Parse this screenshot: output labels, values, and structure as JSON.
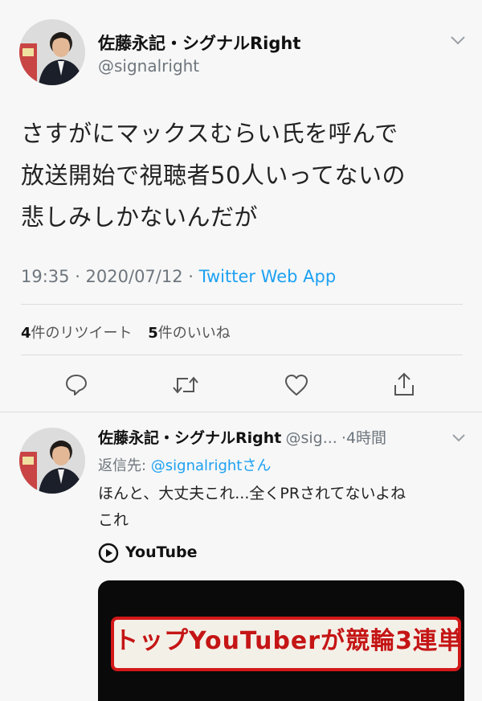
{
  "tweet": {
    "display_name": "佐藤永記・シグナルRight",
    "handle": "@signalright",
    "text_lines": [
      "さすがにマックスむらい氏を呼んで",
      "放送開始で視聴者50人いってないの",
      "悲しみしかないんだが"
    ],
    "time": "19:35 · 2020/07/12 · ",
    "source": "Twitter Web App",
    "retweet_count": "4",
    "retweet_label": "件のリツイート",
    "like_count": "5",
    "like_label": "件のいいね",
    "actions": [
      "reply-icon",
      "retweet-icon",
      "like-icon",
      "share-icon"
    ]
  },
  "reply": {
    "display_name": "佐藤永記・シグナルRight",
    "handle": "@sig...",
    "time": "·4時間",
    "reply_to_prefix": "返信先: ",
    "reply_to_handle": "@signalrightさん",
    "text_lines": [
      "ほんと、大丈夫これ...全くPRされてないよね",
      "これ"
    ],
    "card_source": "YouTube",
    "card_banner_text": "トップYouTuberが競輪3連単"
  },
  "colors": {
    "background": "#f7f7f7",
    "link": "#1da1f2",
    "secondary": "#6e767d",
    "banner_red": "#d21818"
  }
}
